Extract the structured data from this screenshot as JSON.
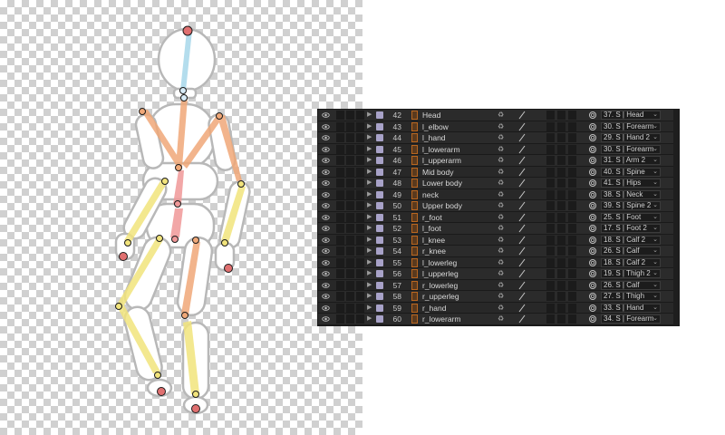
{
  "colors": {
    "head_spine": "#a8d8ea",
    "arm_bone": "#f0a878",
    "leg_bone": "#f2e47c",
    "torso_bone": "#f09898",
    "joint_end": "#e07070",
    "joint_mid": "#d8ecf8",
    "panel_bg": "#232323",
    "label_lavender": "#a8a2c8"
  },
  "icons": {
    "visibility": "eye-icon",
    "twirl": "triangle-right-icon",
    "layer_type": "puppet-pin-layer-icon",
    "shy": "shy-icon",
    "quality": "slash-icon",
    "parent": "pickwhip-icon"
  },
  "layers": [
    {
      "num": "42",
      "name": "Head",
      "parent": "37. S | Head"
    },
    {
      "num": "43",
      "name": "l_elbow",
      "parent": "30. S | Forearm"
    },
    {
      "num": "44",
      "name": "l_hand",
      "parent": "29. S | Hand 2"
    },
    {
      "num": "45",
      "name": "l_lowerarm",
      "parent": "30. S | Forearm"
    },
    {
      "num": "46",
      "name": "l_upperarm",
      "parent": "31. S | Arm 2"
    },
    {
      "num": "47",
      "name": "Mid body",
      "parent": "40. S | Spine"
    },
    {
      "num": "48",
      "name": "Lower body",
      "parent": "41. S | Hips"
    },
    {
      "num": "49",
      "name": "neck",
      "parent": "38. S | Neck"
    },
    {
      "num": "50",
      "name": "Upper body",
      "parent": "39. S | Spine 2"
    },
    {
      "num": "51",
      "name": "r_foot",
      "parent": "25. S | Foot"
    },
    {
      "num": "52",
      "name": "l_foot",
      "parent": "17. S | Foot 2"
    },
    {
      "num": "53",
      "name": "l_knee",
      "parent": "18. S | Calf 2"
    },
    {
      "num": "54",
      "name": "r_knee",
      "parent": "26. S | Calf"
    },
    {
      "num": "55",
      "name": "l_lowerleg",
      "parent": "18. S | Calf 2"
    },
    {
      "num": "56",
      "name": "l_upperleg",
      "parent": "19. S | Thigh 2"
    },
    {
      "num": "57",
      "name": "r_lowerleg",
      "parent": "26. S | Calf"
    },
    {
      "num": "58",
      "name": "r_upperleg",
      "parent": "27. S | Thigh"
    },
    {
      "num": "59",
      "name": "r_hand",
      "parent": "33. S | Hand"
    },
    {
      "num": "60",
      "name": "r_lowerarm",
      "parent": "34. S | Forearm"
    }
  ]
}
